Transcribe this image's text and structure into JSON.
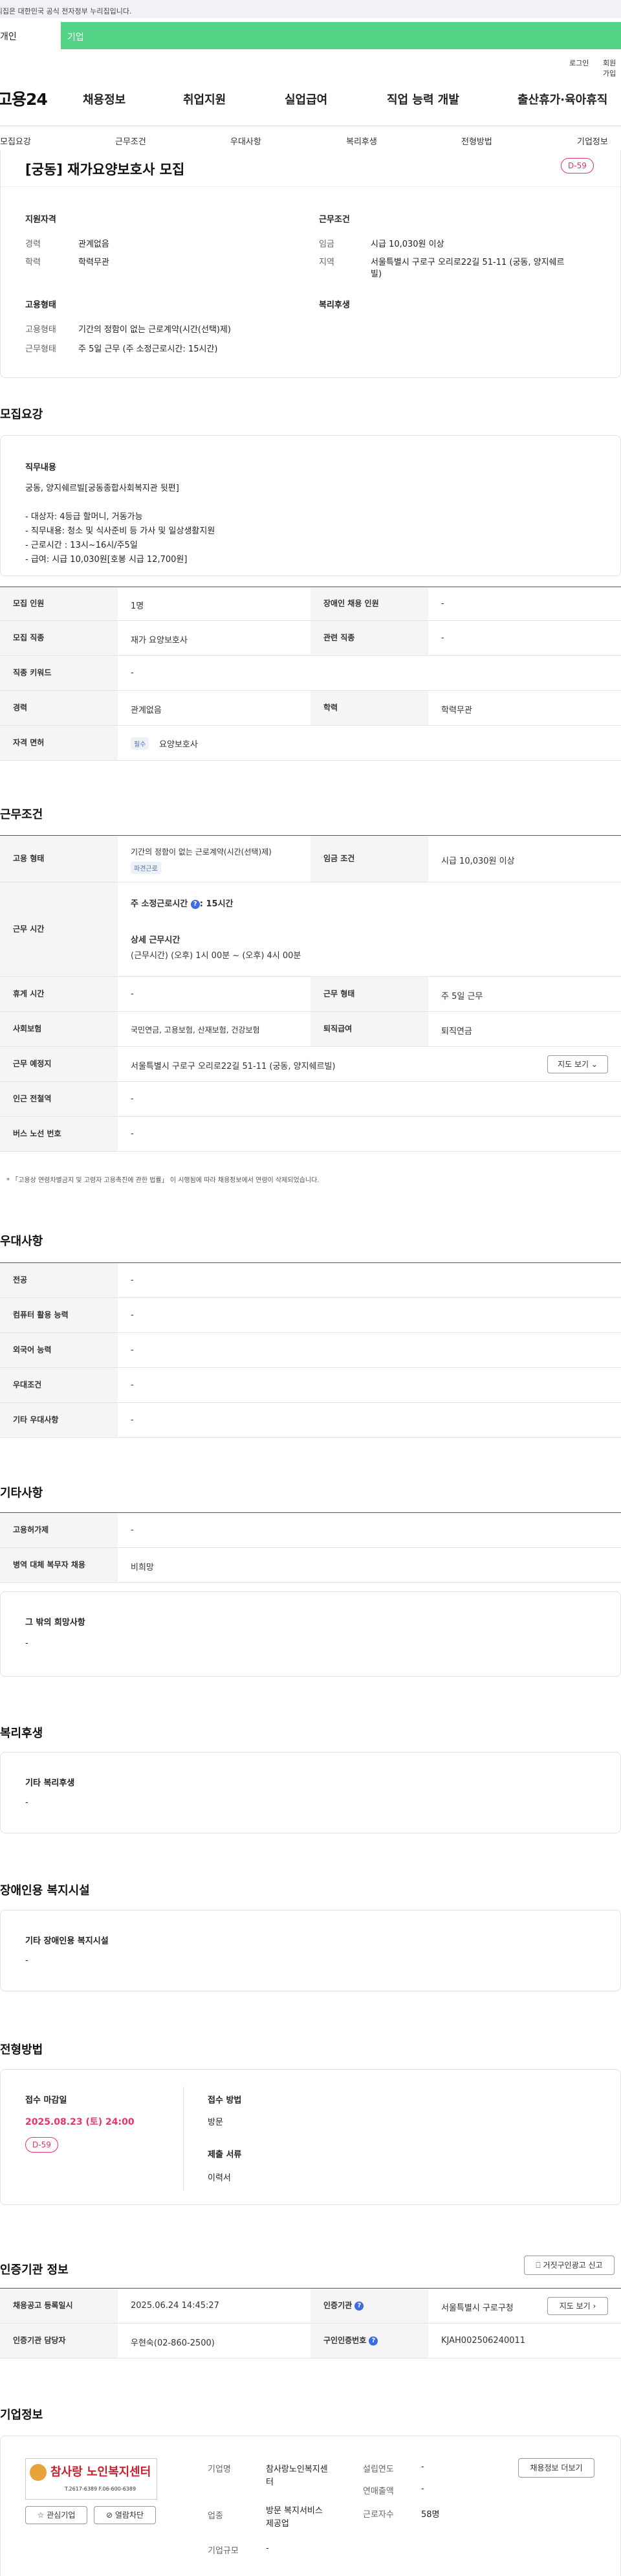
{
  "gov_banner": "이 누리집은 대한민국 공식 전자정부 누리집입니다.",
  "top_tabs": {
    "person": "개인",
    "company": "기업"
  },
  "util": {
    "login": "로그인",
    "join": "회원가입"
  },
  "logo": "고용24",
  "gnb": [
    "채용정보",
    "취업지원",
    "실업급여",
    "직업 능력 개발",
    "출산휴가·육아휴직"
  ],
  "subnav": [
    "모집요강",
    "근무조건",
    "우대사항",
    "복리후생",
    "전형방법",
    "기업정보"
  ],
  "summary": {
    "title": "[궁동] 재가요양보호사 모집",
    "dday": "D-59",
    "qual_heading": "지원자격",
    "career_label": "경력",
    "career": "관계없음",
    "edu_label": "학력",
    "edu": "학력무관",
    "cond_heading": "근무조건",
    "wage_label": "임금",
    "wage": "시급 10,030원 이상",
    "region_label": "지역",
    "region_line1": "서울특별시 구로구 오리로22길 51-11 (궁동, 양지쉐르",
    "region_line2": "빌)",
    "emp_heading": "고용형태",
    "emp_label": "고용형태",
    "emp": "기간의 정함이 없는 근로계약(시간(선택)제)",
    "work_label": "근무형태",
    "work": "주 5일 근무 (주 소정근로시간: 15시간)",
    "welfare_heading": "복리후생"
  },
  "recruit": {
    "heading": "모집요강",
    "duty_heading": "직무내용",
    "duty_lines": [
      "궁동, 양지쉐르빌[궁동종합사회복지관 뒷편]",
      "",
      "- 대상자: 4등급 할머니, 거동가능",
      "- 직무내용: 청소 및 식사준비 등 가사 및 일상생활지원",
      "- 근로시간 : 13시~16시/주5일",
      "- 급여: 시급 10,030원[호봉 시급 12,700원]"
    ],
    "rows": [
      {
        "l1": "모집 인원",
        "v1": "1명",
        "l2": "장애인 채용 인원",
        "v2": "-"
      },
      {
        "l1": "모집 직종",
        "v1": "재가 요양보호사",
        "l2": "관련 직종",
        "v2": "-"
      },
      {
        "l1": "직종 키워드",
        "v1": "-"
      },
      {
        "l1": "경력",
        "v1": "관계없음",
        "l2": "학력",
        "v2": "학력무관"
      },
      {
        "l1": "자격 면허",
        "tag": "필수",
        "v1": "요양보호사"
      }
    ]
  },
  "conditions": {
    "heading": "근무조건",
    "emp_label": "고용 형태",
    "emp": "기간의 정함이 없는 근로계약(시간(선택)제)",
    "emp_tag": "파견근로",
    "wage_label": "임금 조건",
    "wage": "시급 10,030원 이상",
    "time_label": "근무 시간",
    "time_main": "주 소정근로시간",
    "time_hours": ": 15시간",
    "time_detail_title": "상세 근무시간",
    "time_detail": "(근무시간) (오후) 1시 00분 ~ (오후) 4시 00분",
    "rest_label": "휴게 시간",
    "rest": "-",
    "form_label": "근무 형태",
    "form": "주 5일 근무",
    "ins_label": "사회보험",
    "ins": "국민연금, 고용보험, 산재보험, 건강보험",
    "sev_label": "퇴직급여",
    "sev": "퇴직연금",
    "loc_label": "근무 예정지",
    "loc": "서울특별시 구로구 오리로22길 51-11 (궁동, 양지쉐르빌)",
    "map_btn": "지도 보기",
    "station_label": "인근 전철역",
    "station": "-",
    "bus_label": "버스 노선 번호",
    "bus": "-",
    "note": "* 「고용상 연령차별금지 및 고령자 고용촉진에 관한 법률」 이 시행됨에 따라 채용정보에서 연령이 삭제되었습니다."
  },
  "preference": {
    "heading": "우대사항",
    "rows": [
      {
        "l": "전공",
        "v": "-"
      },
      {
        "l": "컴퓨터 활용 능력",
        "v": "-"
      },
      {
        "l": "외국어 능력",
        "v": "-"
      },
      {
        "l": "우대조건",
        "v": "-"
      },
      {
        "l": "기타 우대사항",
        "v": "-"
      }
    ]
  },
  "etc": {
    "heading": "기타사항",
    "rows": [
      {
        "l": "고용허가제",
        "v": "-"
      },
      {
        "l": "병역 대체 복무자 채용",
        "v": "비희망"
      }
    ],
    "other_title": "그 밖의 희망사항",
    "other_value": "-"
  },
  "welfare": {
    "heading": "복리후생",
    "box_title": "기타 복리후생",
    "box_value": "-"
  },
  "facility": {
    "heading": "장애인용 복지시설",
    "box_title": "기타 장애인용 복지시설",
    "box_value": "-"
  },
  "selection": {
    "heading": "전형방법",
    "deadline_label": "접수 마감일",
    "deadline": "2025.08.23 (토) 24:00",
    "dday": "D-59",
    "method_label": "접수 방법",
    "method": "방문",
    "docs_label": "제출 서류",
    "docs": "이력서"
  },
  "cert": {
    "heading": "인증기관 정보",
    "report_btn": "거짓구인광고 신고",
    "reg_label": "채용공고 등록일시",
    "reg": "2025.06.24 14:45:27",
    "agency_label": "인증기관",
    "agency": "서울특별시 구로구청",
    "manager_label": "인증기관 담당자",
    "manager": "우현숙(02-860-2500)",
    "num_label": "구인인증번호",
    "num": "KJAH002506240011",
    "map_btn": "지도 보기"
  },
  "company": {
    "heading": "기업정보",
    "logo_name": "참사랑 노인복지센터",
    "logo_phone": "T.2617-6389  F.06-600-6389",
    "fav_btn": "관심기업",
    "block_btn": "열람차단",
    "name_label": "기업명",
    "name_line1": "참사랑노인복지센",
    "name_line2": "터",
    "year_label": "설립연도",
    "year": "-",
    "industry_label": "업종",
    "ind_line1": "방문 복지서비스",
    "ind_line2": "제공업",
    "sales_label": "연매출액",
    "sales": "-",
    "emp_label": "근로자수",
    "emp": "58명",
    "size_label": "기업규모",
    "size": "-",
    "more_btn": "채용정보 더보기"
  },
  "colors": {
    "accent": "#54d486",
    "dday": "#e8336e",
    "info": "#3b6de0"
  }
}
